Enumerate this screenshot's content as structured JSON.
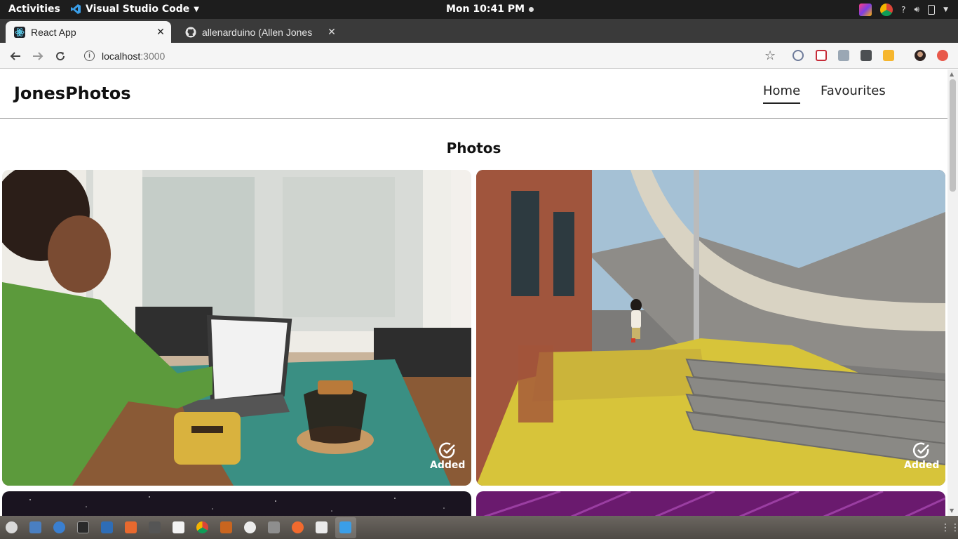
{
  "os": {
    "activities": "Activities",
    "app_menu": "Visual Studio Code",
    "clock": "Mon 10:41 PM",
    "help": "?"
  },
  "browser": {
    "tabs": [
      {
        "title": "React App",
        "icon": "react-icon",
        "active": true
      },
      {
        "title": "allenarduino (Allen Jones",
        "icon": "github-icon",
        "active": false
      }
    ],
    "new_tab": "+",
    "close": "✕",
    "url_host": "localhost",
    "url_port": ":3000"
  },
  "site": {
    "brand": "JonesPhotos",
    "nav": {
      "home": "Home",
      "favourites": "Favourites"
    },
    "section_title": "Photos",
    "photos": [
      {
        "subject": "woman-laptop-coffee",
        "status": "Added"
      },
      {
        "subject": "child-staircase-slide",
        "status": "Added"
      },
      {
        "subject": "night-sky",
        "status": ""
      },
      {
        "subject": "purple-lines",
        "status": ""
      }
    ]
  },
  "colors": {
    "topbar": "#1d1d1d",
    "tabstrip": "#3a3a3a",
    "toolbar": "#f5f5f5",
    "taskbar": "#5b5650",
    "accent": "#222222"
  }
}
